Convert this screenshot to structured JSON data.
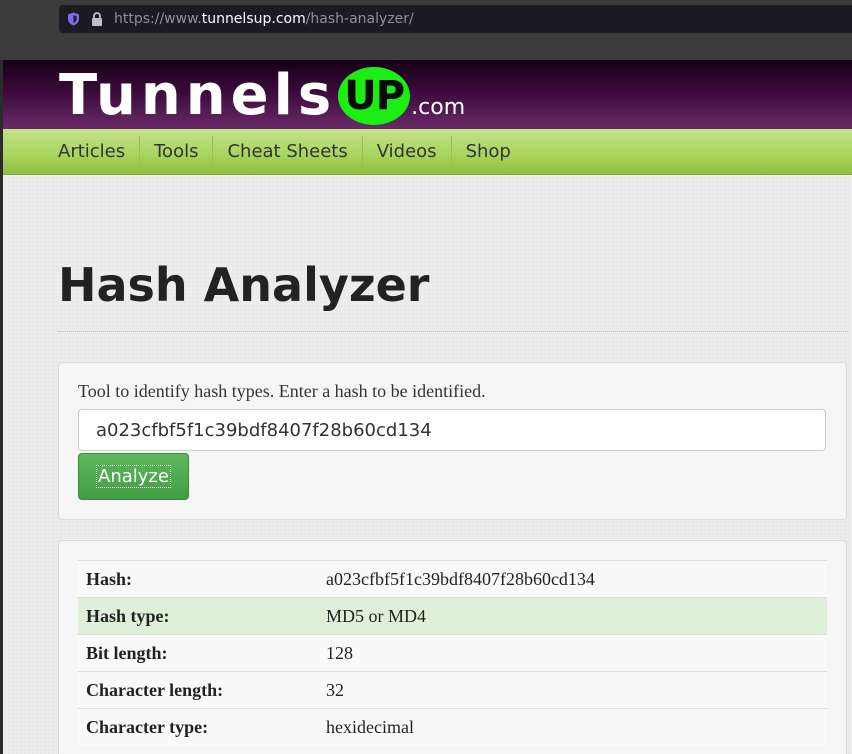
{
  "browser": {
    "url_prefix": "https://www.",
    "url_host": "tunnelsup.com",
    "url_path": "/hash-analyzer/"
  },
  "site": {
    "logo_word": "Tunnels",
    "logo_badge": "UP",
    "logo_suffix": ".com",
    "badge_color": "#1aee12"
  },
  "nav": {
    "items": [
      "Articles",
      "Tools",
      "Cheat Sheets",
      "Videos",
      "Shop"
    ]
  },
  "page_title": "Hash Analyzer",
  "analyzer": {
    "description": "Tool to identify hash types. Enter a hash to be identified.",
    "input_value": "a023cfbf5f1c39bdf8407f28b60cd134",
    "button_label": "Analyze"
  },
  "results": [
    {
      "label": "Hash:",
      "value": "a023cfbf5f1c39bdf8407f28b60cd134"
    },
    {
      "label": "Hash type:",
      "value": "MD5 or MD4"
    },
    {
      "label": "Bit length:",
      "value": "128"
    },
    {
      "label": "Character length:",
      "value": "32"
    },
    {
      "label": "Character type:",
      "value": "hexidecimal"
    }
  ],
  "highlight_color": "#dff0d8"
}
